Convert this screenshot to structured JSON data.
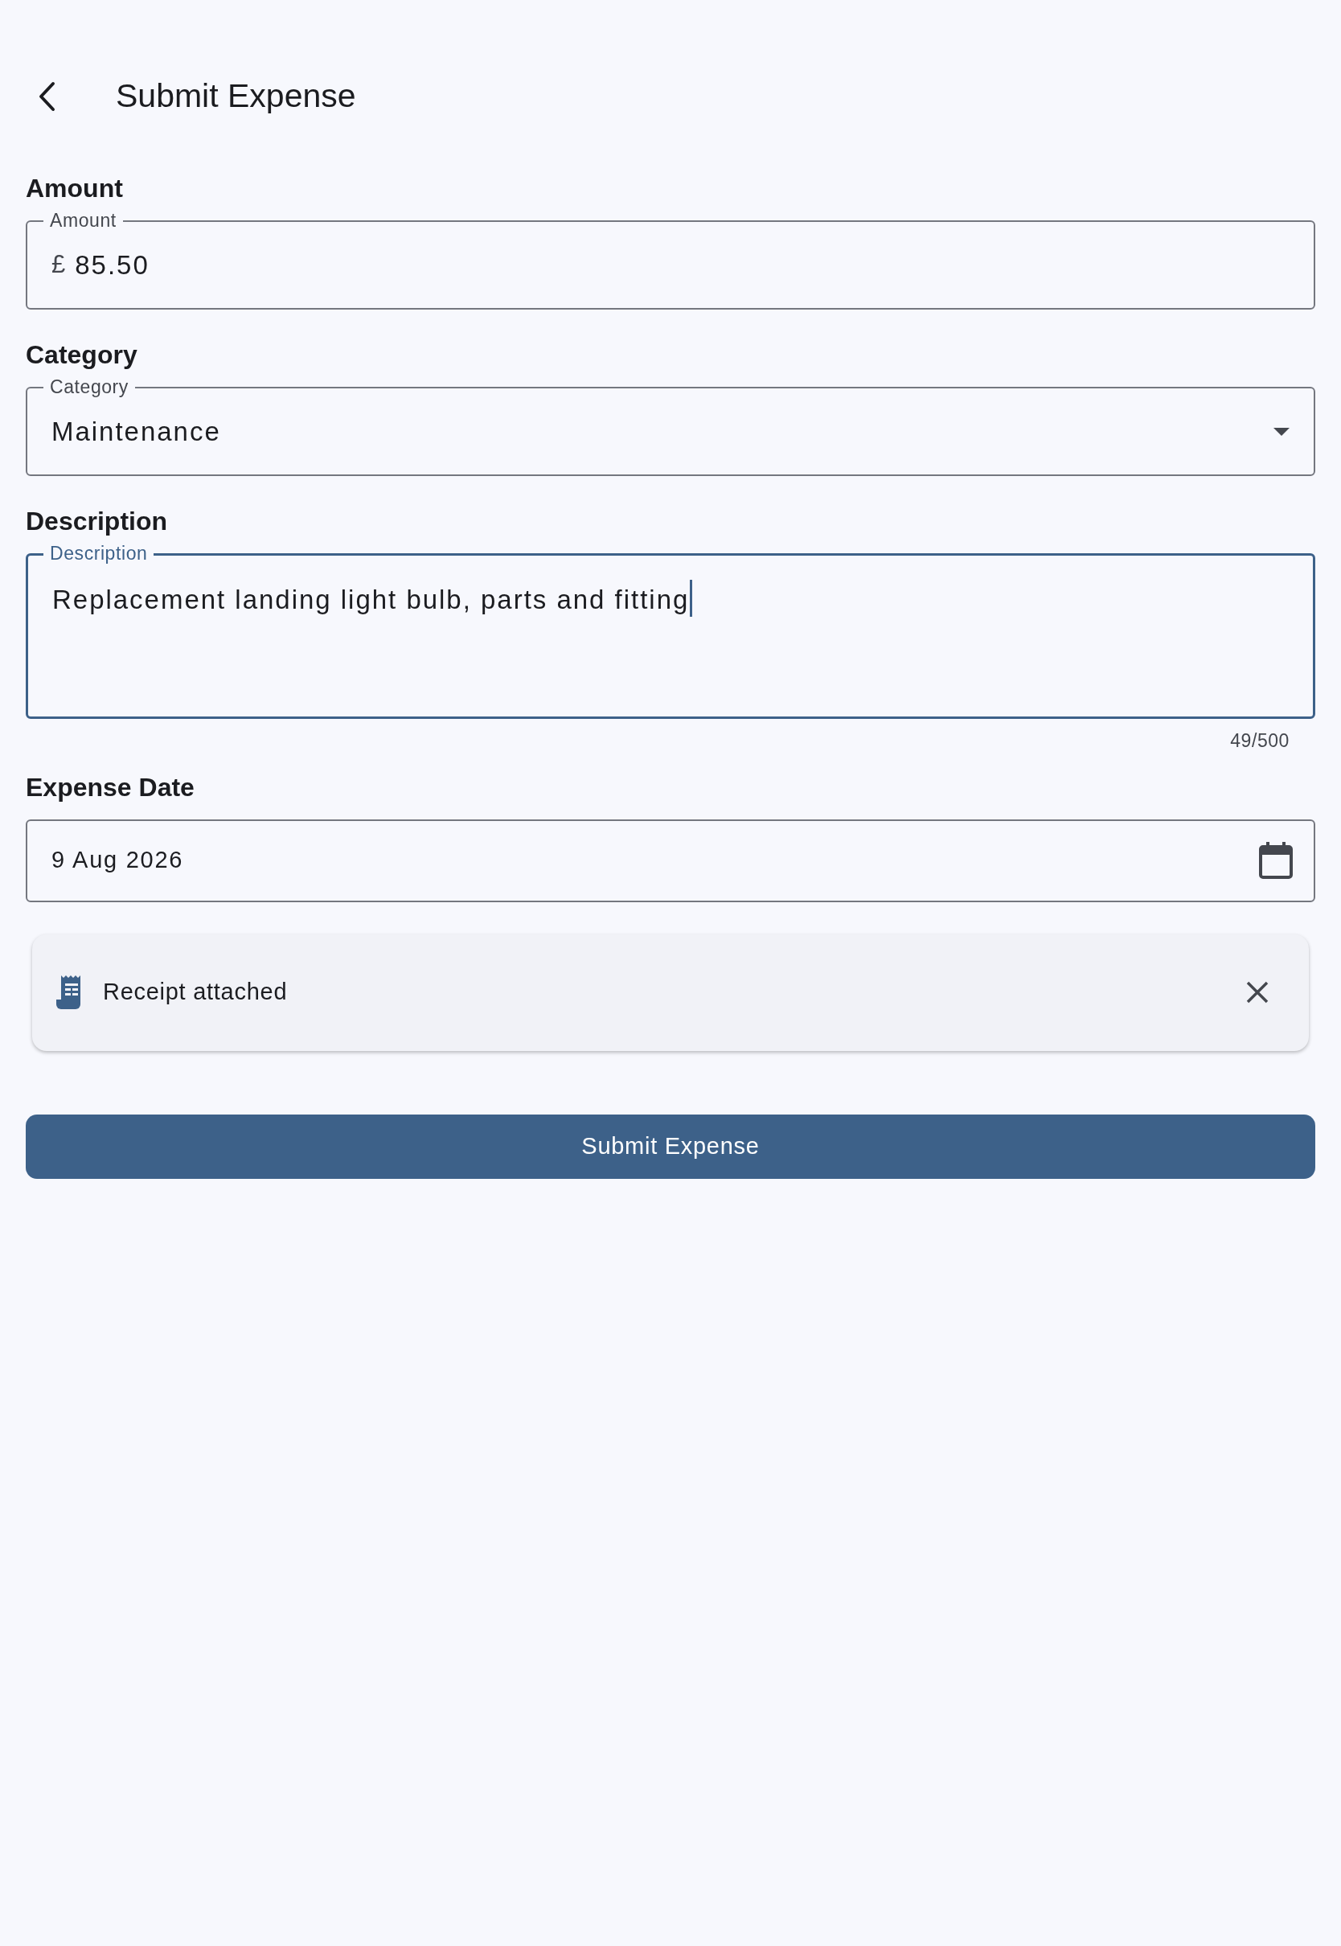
{
  "header": {
    "title": "Submit Expense"
  },
  "fields": [
    {
      "kind": "amount",
      "heading": "Amount",
      "label": "Amount",
      "prefix": "£",
      "value": "85.50",
      "focused": false
    },
    {
      "kind": "select",
      "heading": "Category",
      "label": "Category",
      "value": "Maintenance",
      "focused": false
    },
    {
      "kind": "textarea",
      "heading": "Description",
      "label": "Description",
      "value": "Replacement landing light bulb, parts and fitting",
      "counter": "49/500",
      "focused": true
    },
    {
      "kind": "date",
      "heading": "Expense Date",
      "value": "9 Aug 2026",
      "focused": false
    }
  ],
  "receipt": {
    "text": "Receipt attached"
  },
  "submit_button": "Submit Expense"
}
